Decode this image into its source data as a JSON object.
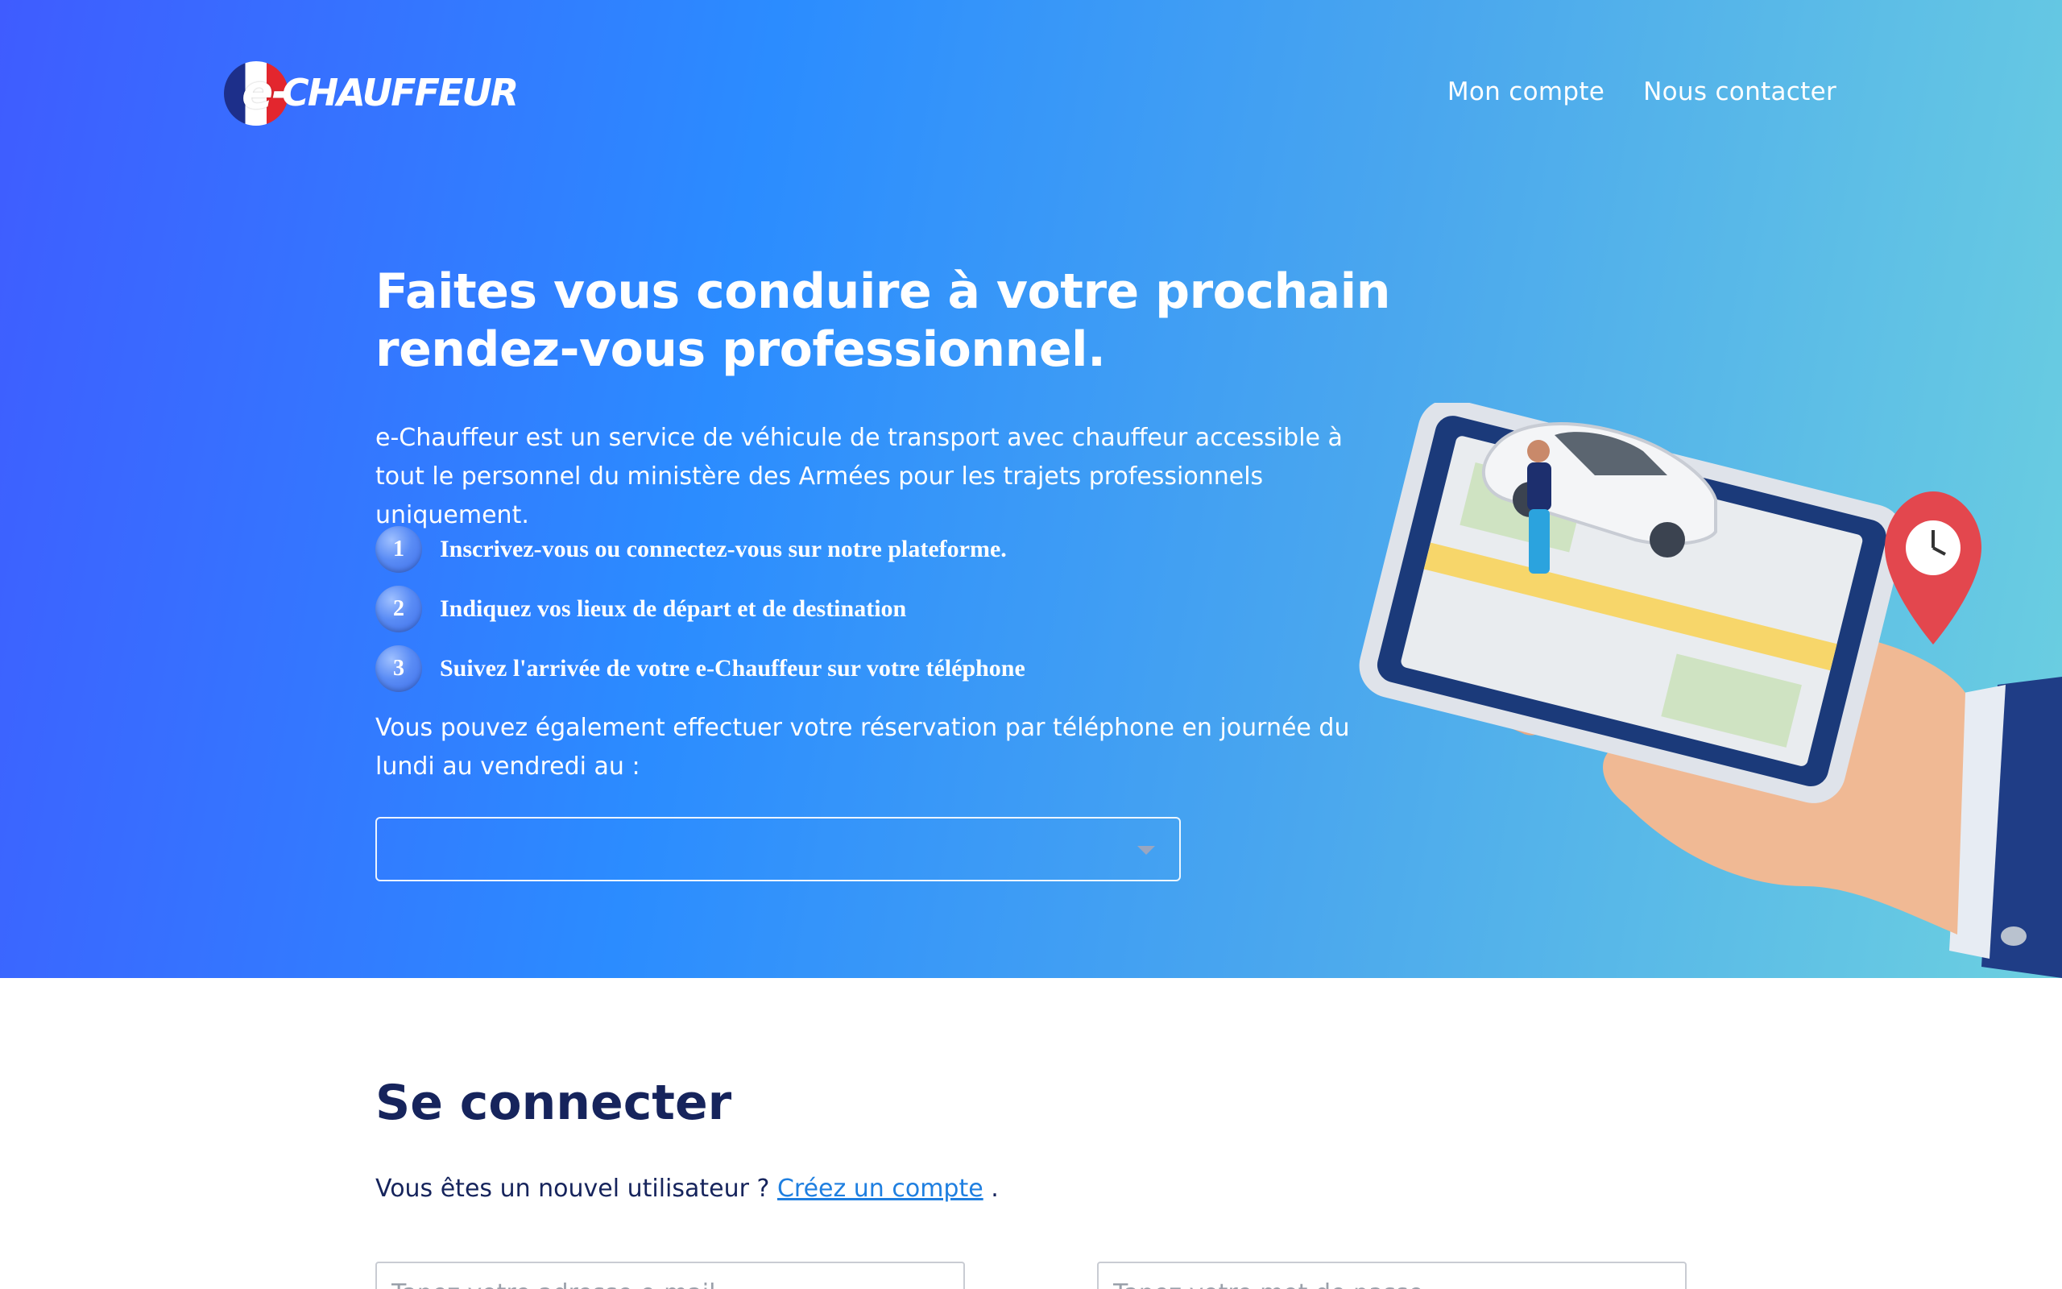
{
  "brand": {
    "logo_text": "e-CHAUFFEUR"
  },
  "nav": {
    "account": "Mon compte",
    "contact": "Nous contacter"
  },
  "hero": {
    "title": "Faites vous conduire à votre prochain rendez-vous professionnel.",
    "description": "e-Chauffeur est un service de véhicule de transport avec chauffeur accessible à tout le personnel du ministère des Armées pour les trajets professionnels uniquement.",
    "steps": [
      {
        "num": "1",
        "text": "Inscrivez-vous ou connectez-vous sur notre plateforme."
      },
      {
        "num": "2",
        "text": "Indiquez vos lieux de départ et de destination"
      },
      {
        "num": "3",
        "text": "Suivez l'arrivée de votre e-Chauffeur sur votre téléphone"
      }
    ],
    "phone_note": "Vous pouvez également effectuer votre réservation par téléphone en journée du lundi au vendredi au :",
    "phone_select_value": ""
  },
  "login": {
    "title": "Se connecter",
    "new_user_prefix": "Vous êtes un nouvel utilisateur ?",
    "create_account_link": "Créez un compte",
    "suffix": ".",
    "email_placeholder": "Tapez votre adresse e-mail",
    "password_placeholder": "Tapez votre mot de passe"
  },
  "colors": {
    "gradient_start": "#3f5cff",
    "gradient_mid": "#2b8cff",
    "gradient_end": "#6cd0e0",
    "heading_navy": "#16245c",
    "link_blue": "#1f7fe0"
  },
  "icons": {
    "step_badge": "numbered-circle-icon",
    "select_caret": "chevron-down-icon"
  }
}
